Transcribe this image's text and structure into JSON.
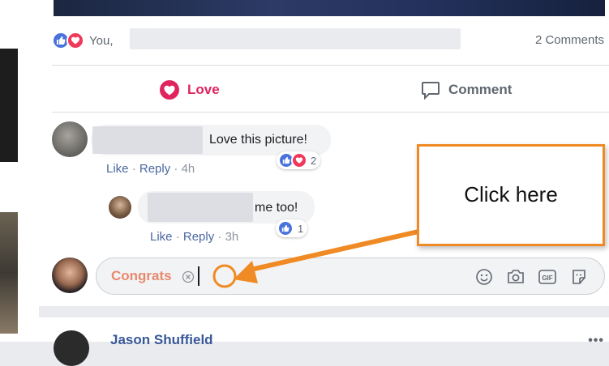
{
  "post": {
    "reactors_prefix": "You,",
    "comments_count": "2 Comments",
    "actions": {
      "love_label": "Love",
      "comment_label": "Comment"
    }
  },
  "comments": [
    {
      "text": "Love this picture!",
      "like_label": "Like",
      "reply_label": "Reply",
      "time": "4h",
      "reaction_count": "2"
    },
    {
      "text": "me too!",
      "like_label": "Like",
      "reply_label": "Reply",
      "time": "3h",
      "reaction_count": "1"
    }
  ],
  "composer": {
    "value": "Congrats",
    "tools": [
      "smiley-icon",
      "camera-icon",
      "gif-icon",
      "sticker-icon"
    ]
  },
  "next_post": {
    "author": "Jason Shuffield"
  },
  "callout": {
    "text": "Click here"
  },
  "colors": {
    "accent_love": "#e0245e",
    "link_blue": "#4b67a1",
    "callout_orange": "#f08a24",
    "like_blue": "#4a72dc"
  }
}
